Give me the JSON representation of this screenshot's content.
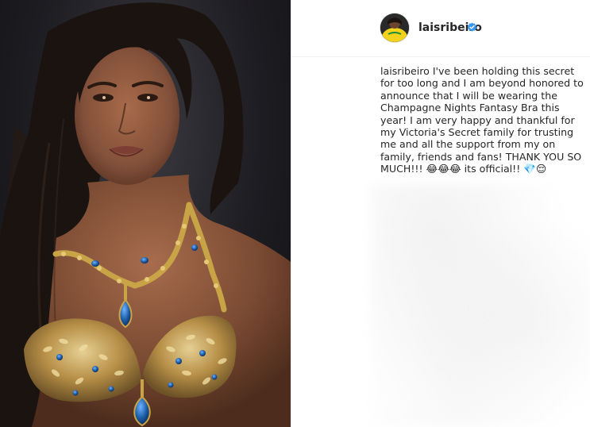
{
  "post": {
    "username": "laisribeiro",
    "verified_icon": "verified-badge-icon",
    "caption": {
      "user": "laisribeiro",
      "text": "I've been holding this secret for too long and I am beyond honored to announce that I will be wearing the Champagne Nights Fantasy Bra this year! I am very happy and thankful for my Victoria's Secret family for trusting me and all the support from my on family, friends and fans! THANK YOU SO MUCH!!! 😂😂😂 its official!! 💎😌"
    },
    "media_icon": "photo-image",
    "avatar_icon": "avatar-image"
  },
  "colors": {
    "username": "#262626",
    "verified": "#3897f0",
    "border": "#efefef",
    "gold": "#c9a447",
    "sapphire": "#1f5fa8"
  }
}
